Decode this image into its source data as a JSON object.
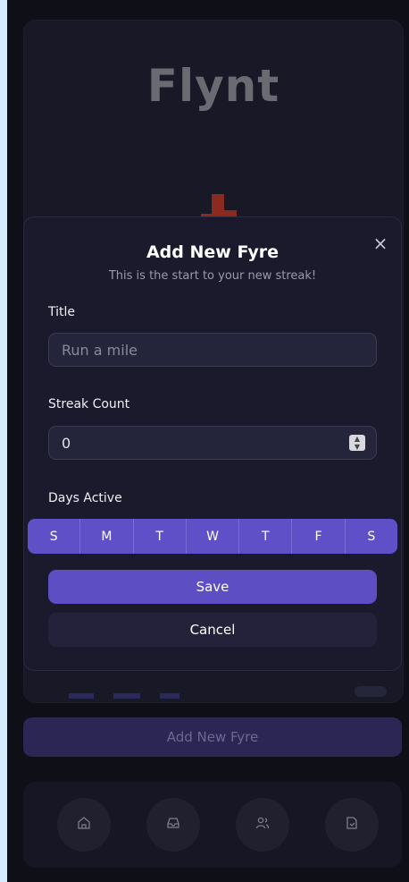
{
  "app": {
    "title": "Flynt"
  },
  "modal": {
    "title": "Add New Fyre",
    "subtitle": "This is the start to your new streak!",
    "close_label": "×",
    "title_field": {
      "label": "Title",
      "placeholder": "Run a mile",
      "value": ""
    },
    "streak_field": {
      "label": "Streak Count",
      "value": "0"
    },
    "days_label": "Days Active",
    "days": [
      "S",
      "M",
      "T",
      "W",
      "T",
      "F",
      "S"
    ],
    "save_label": "Save",
    "cancel_label": "Cancel"
  },
  "add_button": {
    "label": "Add New Fyre"
  },
  "nav": {
    "items": [
      "home-icon",
      "inbox-icon",
      "users-icon",
      "file-icon"
    ]
  },
  "colors": {
    "accent": "#5d4ec3",
    "days_bg": "#6050c8",
    "background": "#0f0f17",
    "flame": "#8b2a1e"
  }
}
